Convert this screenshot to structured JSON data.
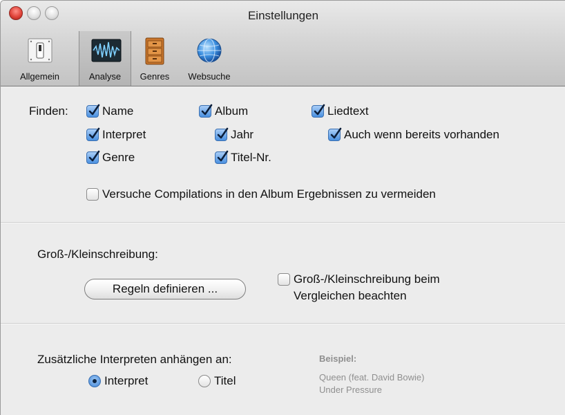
{
  "window": {
    "title": "Einstellungen"
  },
  "toolbar": {
    "items": [
      {
        "label": "Allgemein",
        "icon": "switch-icon",
        "selected": false
      },
      {
        "label": "Analyse",
        "icon": "waveform-icon",
        "selected": true
      },
      {
        "label": "Genres",
        "icon": "cabinet-icon",
        "selected": false
      },
      {
        "label": "Websuche",
        "icon": "globe-icon",
        "selected": false
      }
    ]
  },
  "find": {
    "label": "Finden:",
    "options": [
      {
        "label": "Name",
        "checked": true
      },
      {
        "label": "Album",
        "checked": true
      },
      {
        "label": "Liedtext",
        "checked": true
      },
      {
        "label": "Interpret",
        "checked": true
      },
      {
        "label": "Jahr",
        "checked": true
      },
      {
        "label": "Auch wenn bereits vorhanden",
        "checked": true
      },
      {
        "label": "Genre",
        "checked": true
      },
      {
        "label": "Titel-Nr.",
        "checked": true
      }
    ],
    "avoid_compilations": {
      "label": "Versuche Compilations in den Album Ergebnissen zu vermeiden",
      "checked": false
    }
  },
  "case": {
    "heading": "Groß-/Kleinschreibung:",
    "button_label": "Regeln definieren ...",
    "compare": {
      "label_line1": "Groß-/Kleinschreibung beim",
      "label_line2": "Vergleichen beachten",
      "checked": false
    }
  },
  "append": {
    "heading": "Zusätzliche Interpreten anhängen an:",
    "options": [
      {
        "label": "Interpret",
        "selected": true
      },
      {
        "label": "Titel",
        "selected": false
      }
    ],
    "example": {
      "heading": "Beispiel:",
      "line1": "Queen (feat. David Bowie)",
      "line2": "Under Pressure"
    }
  },
  "colors": {
    "accent": "#4a90e0",
    "close_button": "#e0443a",
    "window_background": "#ececec",
    "example_text": "#8f8f8f"
  }
}
